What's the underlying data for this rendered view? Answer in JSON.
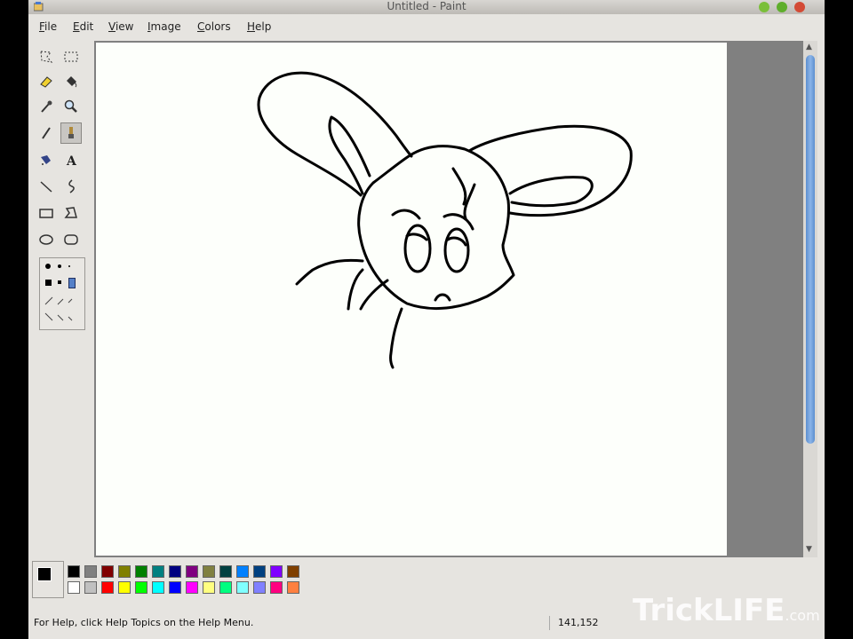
{
  "window": {
    "title": "Untitled - Paint"
  },
  "menu": [
    {
      "mnemonic": "F",
      "rest": "ile"
    },
    {
      "mnemonic": "E",
      "rest": "dit"
    },
    {
      "mnemonic": "V",
      "rest": "iew"
    },
    {
      "mnemonic": "I",
      "rest": "mage"
    },
    {
      "mnemonic": "C",
      "rest": "olors"
    },
    {
      "mnemonic": "H",
      "rest": "elp"
    }
  ],
  "tools": [
    "free-select-icon",
    "rect-select-icon",
    "eraser-icon",
    "fill-bucket-icon",
    "color-picker-icon",
    "magnifier-icon",
    "pencil-icon",
    "brush-icon",
    "airbrush-icon",
    "text-icon",
    "line-icon",
    "curve-icon",
    "rectangle-icon",
    "polygon-icon",
    "ellipse-icon",
    "rounded-rect-icon"
  ],
  "active_tool": "brush-icon",
  "palette": {
    "foreground": "#000000",
    "background": "#ffffff",
    "colors_top": [
      "#000000",
      "#808080",
      "#800000",
      "#808000",
      "#008000",
      "#008080",
      "#000080",
      "#800080",
      "#808040",
      "#004040",
      "#0080ff",
      "#004080",
      "#8000ff",
      "#804000"
    ],
    "colors_bottom": [
      "#ffffff",
      "#c0c0c0",
      "#ff0000",
      "#ffff00",
      "#00ff00",
      "#00ffff",
      "#0000ff",
      "#ff00ff",
      "#ffff80",
      "#00ff80",
      "#80ffff",
      "#8080ff",
      "#ff0080",
      "#ff8040"
    ]
  },
  "status": {
    "help_text": "For Help, click Help Topics on the Help Menu.",
    "coordinates": "141,152"
  },
  "watermark": {
    "main": "TrickLIFE",
    "suffix": ".com"
  }
}
